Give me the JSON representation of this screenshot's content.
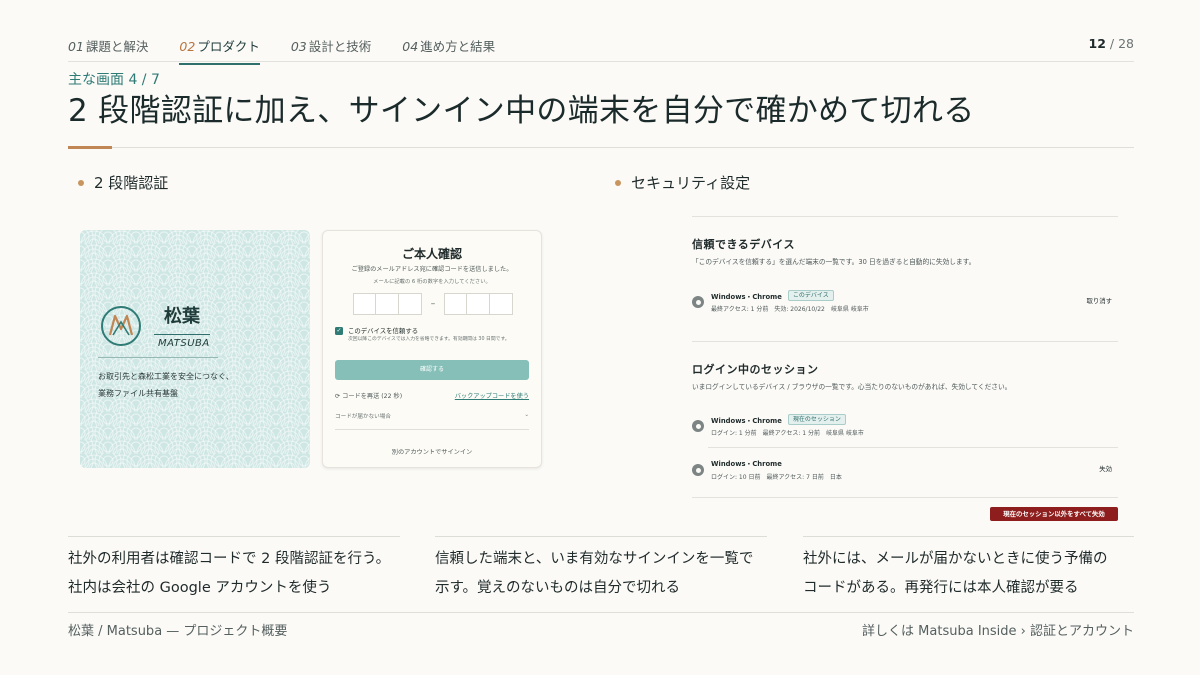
{
  "nav": {
    "items": [
      {
        "num": "01",
        "label": "課題と解決"
      },
      {
        "num": "02",
        "label": "プロダクト"
      },
      {
        "num": "03",
        "label": "設計と技術"
      },
      {
        "num": "04",
        "label": "進め方と結果"
      }
    ],
    "active_index": 1,
    "page_current": "12",
    "page_separator": "/",
    "page_total": "28"
  },
  "header": {
    "eyebrow": "主な画面 4 / 7",
    "title": "2 段階認証に加え、サインイン中の端末を自分で確かめて切れる"
  },
  "left_section": {
    "label": "2 段階認証",
    "brand": {
      "kanji": "松葉",
      "roman": "MATSUBA",
      "tagline_line1": "お取引先と森松工業を安全につなぐ、",
      "tagline_line2": "業務ファイル共有基盤"
    },
    "card": {
      "title": "ご本人確認",
      "desc1": "ご登録のメールアドレス宛に確認コードを送信しました。",
      "desc2": "メールに記載の 6 桁の数字を入力してください。",
      "code_separator": "–",
      "trust_label": "このデバイスを信頼する",
      "trust_sub": "次回以降このデバイスでは入力を省略できます。有効期間は 30 日間です。",
      "confirm_button": "確認する",
      "resend": "コードを再送 (22 秒)",
      "backup_link": "バックアップコードを使う",
      "no_code": "コードが届かない場合",
      "other_account": "別のアカウントでサインイン"
    }
  },
  "right_section": {
    "label": "セキュリティ設定",
    "trusted": {
      "heading": "信頼できるデバイス",
      "desc": "「このデバイスを信頼する」を選んだ端末の一覧です。30 日を過ぎると自動的に失効します。",
      "devices": [
        {
          "name": "Windows・Chrome",
          "badge": "このデバイス",
          "meta": "最終アクセス: 1 分前　失効: 2026/10/22　岐阜県 岐阜市",
          "action": "取り消す"
        }
      ]
    },
    "sessions": {
      "heading": "ログイン中のセッション",
      "desc": "いまログインしているデバイス / ブラウザの一覧です。心当たりのないものがあれば、失効してください。",
      "items": [
        {
          "name": "Windows・Chrome",
          "badge": "現在のセッション",
          "meta": "ログイン: 1 分前　最終アクセス: 1 分前　岐阜県 岐阜市",
          "action": ""
        },
        {
          "name": "Windows・Chrome",
          "badge": "",
          "meta": "ログイン: 10 日前　最終アクセス: 7 日前　日本",
          "action": "失効"
        }
      ],
      "revoke_all": "現在のセッション以外をすべて失効"
    }
  },
  "columns": [
    {
      "line1": "社外の利用者は確認コードで 2 段階認証を行う。",
      "line2": "社内は会社の Google アカウントを使う"
    },
    {
      "line1": "信頼した端末と、いま有効なサインインを一覧で",
      "line2": "示す。覚えのないものは自分で切れる"
    },
    {
      "line1": "社外には、メールが届かないときに使う予備の",
      "line2": "コードがある。再発行には本人確認が要る"
    }
  ],
  "footer": {
    "left": "松葉 / Matsuba — プロジェクト概要",
    "right": "詳しくは Matsuba Inside › 認証とアカウント"
  },
  "colors": {
    "accent_teal": "#2f7b75",
    "accent_copper": "#c08653",
    "danger": "#8e1d1d"
  }
}
